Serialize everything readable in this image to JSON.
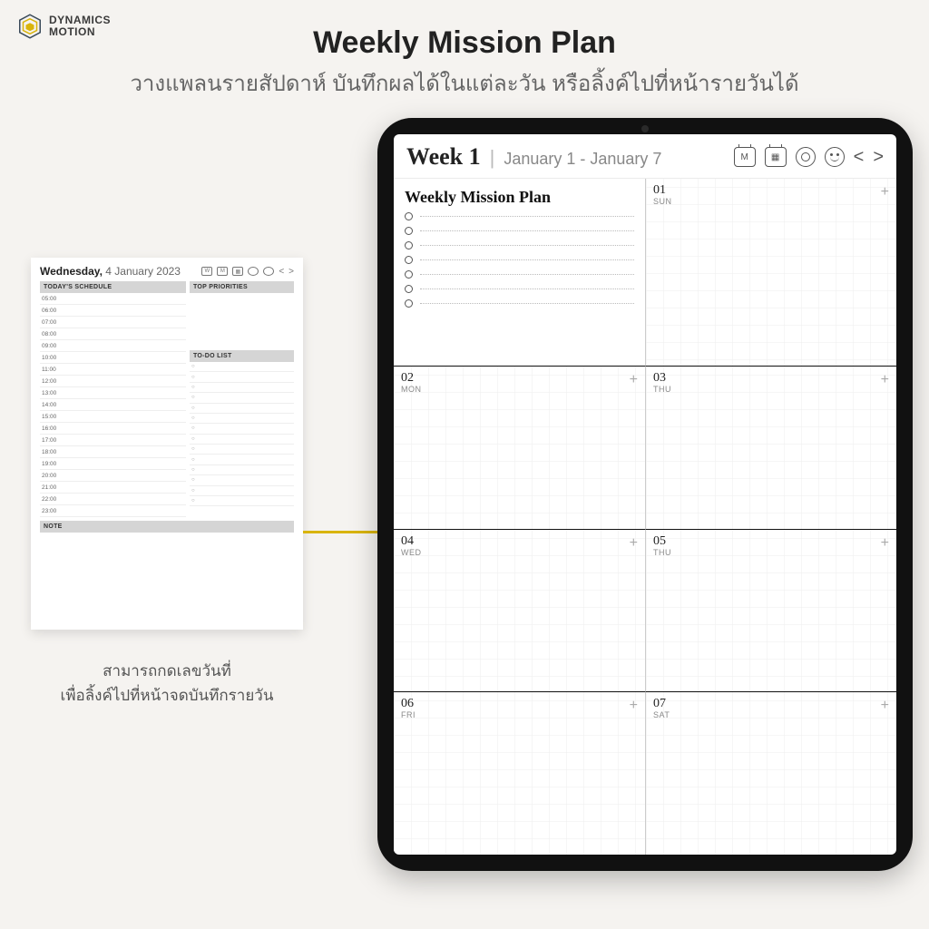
{
  "brand": {
    "line1": "DYNAMICS",
    "line2": "MOTION"
  },
  "page": {
    "title": "Weekly Mission Plan",
    "subtitle": "วางแพลนรายสัปดาห์ บันทึกผลได้ในแต่ละวัน หรือลิ้งค์ไปที่หน้ารายวันได้"
  },
  "daily": {
    "weekday": "Wednesday,",
    "date_rest": " 4 January 2023",
    "schedule_label": "TODAY'S SCHEDULE",
    "priorities_label": "TOP PRIORITIES",
    "todo_label": "TO-DO LIST",
    "note_label": "NOTE",
    "hours": [
      "05:00",
      "06:00",
      "07:00",
      "08:00",
      "09:00",
      "10:00",
      "11:00",
      "12:00",
      "13:00",
      "14:00",
      "15:00",
      "16:00",
      "17:00",
      "18:00",
      "19:00",
      "20:00",
      "21:00",
      "22:00",
      "23:00"
    ],
    "todo_bullet": "○",
    "caption_line1": "สามารถกดเลขวันที่",
    "caption_line2": "เพื่อลิ้งค์ไปที่หน้าจดบันทึกรายวัน"
  },
  "week": {
    "label": "Week 1",
    "sep": "|",
    "range": "January 1 - January 7",
    "month_icon": "M",
    "prev": "<",
    "next": ">",
    "mission_title": "Weekly Mission Plan",
    "plus": "+",
    "days": [
      {
        "num": "01",
        "dow": "SUN"
      },
      {
        "num": "02",
        "dow": "MON"
      },
      {
        "num": "03",
        "dow": "THU"
      },
      {
        "num": "04",
        "dow": "WED"
      },
      {
        "num": "05",
        "dow": "THU"
      },
      {
        "num": "06",
        "dow": "FRI"
      },
      {
        "num": "07",
        "dow": "SAT"
      }
    ]
  }
}
